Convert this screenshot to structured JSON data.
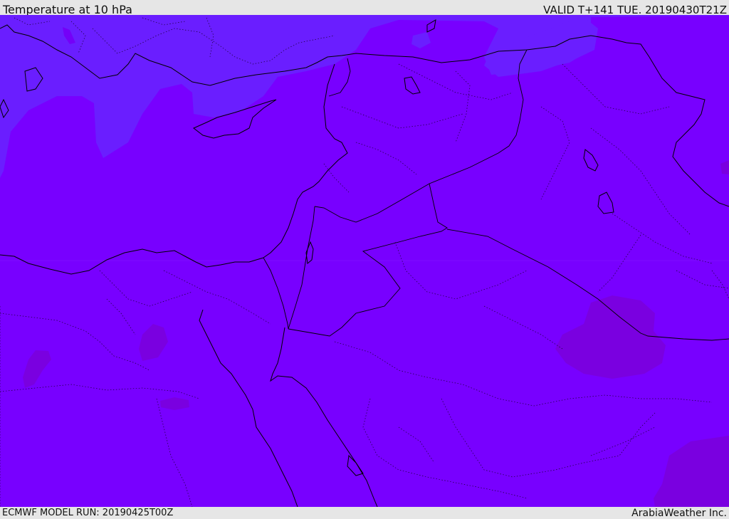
{
  "header": {
    "title": "Temperature at 10 hPa",
    "valid_time": "VALID T+141 TUE. 20190430T21Z"
  },
  "footer": {
    "model_run": "ECMWF MODEL RUN: 20190425T00Z",
    "credit": "ArabiaWeather Inc."
  },
  "map": {
    "colors": {
      "base_fill": "#7800ff",
      "cold_region": "#6a1eff",
      "warm_region": "#7a00e0",
      "coastline": "#000000",
      "borders": "#1a0033"
    }
  }
}
